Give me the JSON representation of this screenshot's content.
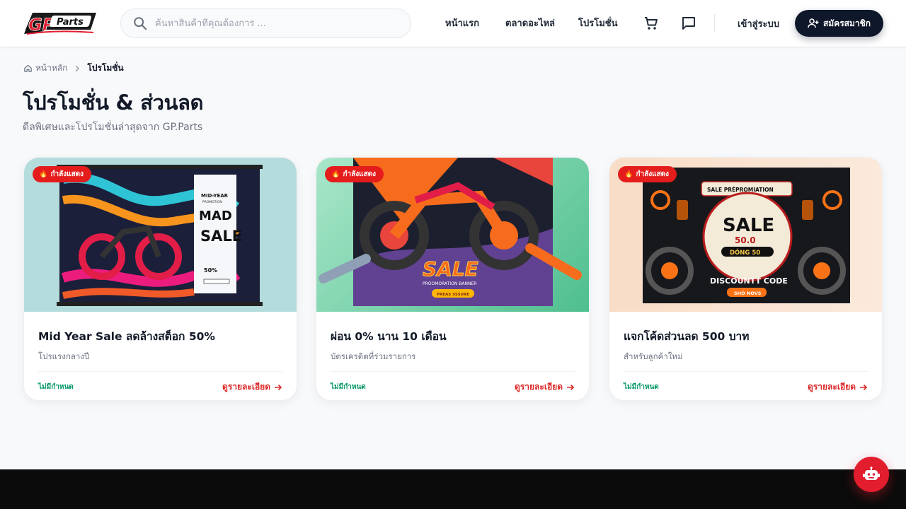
{
  "brand": {
    "logo_text": "GP Parts",
    "accent": "#e11d2e",
    "dark": "#0f172a"
  },
  "header": {
    "search_placeholder": "ค้นหาสินค้าที่คุณต้องการ ...",
    "nav": [
      {
        "label": "หน้าแรก"
      },
      {
        "label": "ตลาดอะไหล่"
      },
      {
        "label": "โปรโมชั่น"
      }
    ],
    "icons": [
      "cart-icon",
      "chat-icon"
    ],
    "login_label": "เข้าสู่ระบบ",
    "signup_label": "สมัครสมาชิก"
  },
  "breadcrumb": {
    "home": "หน้าหลัก",
    "current": "โปรโมชั่น"
  },
  "page": {
    "title": "โปรโมชั่น & ส่วนลด",
    "subtitle": "ดีลพิเศษและโปรโมชั่นล่าสุดจาก GP.Parts"
  },
  "promotions": [
    {
      "badge": "กำลังแสดง",
      "title": "Mid Year Sale ลดล้างสต็อก 50%",
      "subtitle": "โปรแรงกลางปี",
      "expiry": "ไม่มีกำหนด",
      "link_label": "ดูรายละเอียด",
      "banner_texts": [
        "MID-YEAR",
        "PROMOTION",
        "MAD",
        "SALE",
        "50%"
      ]
    },
    {
      "badge": "กำลังแสดง",
      "title": "ผ่อน 0% นาน 10 เดือน",
      "subtitle": "บัตรเครดิตที่ร่วมรายการ",
      "expiry": "ไม่มีกำหนด",
      "link_label": "ดูรายละเอียด",
      "banner_texts": [
        "SALE",
        "PROOMORATION BANNER",
        "PREAS SSSURE"
      ]
    },
    {
      "badge": "กำลังแสดง",
      "title": "แจกโค้ดส่วนลด 500 บาท",
      "subtitle": "สำหรับลูกค้าใหม่",
      "expiry": "ไม่มีกำหนด",
      "link_label": "ดูรายละเอียด",
      "banner_texts": [
        "SALE PRÉPROMIATION",
        "SALE",
        "50.0",
        "DÓNG 50",
        "DISCOUNTT CODE",
        "SHÓ NOVS"
      ]
    }
  ],
  "chatbot": {
    "icon": "robot-icon"
  }
}
